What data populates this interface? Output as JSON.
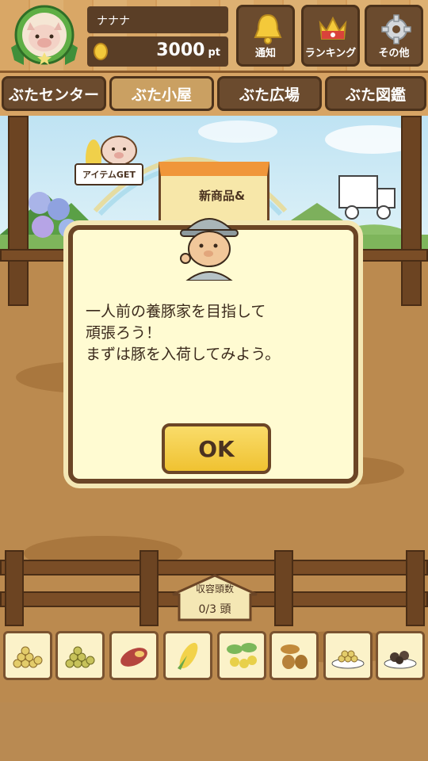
{
  "header": {
    "player_name": "ナナナ",
    "points_value": "3000",
    "points_unit": "pt",
    "buttons": [
      {
        "label": "通知",
        "icon": "bell-icon"
      },
      {
        "label": "ランキング",
        "icon": "crown-icon"
      },
      {
        "label": "その他",
        "icon": "gear-icon"
      }
    ]
  },
  "tabs": [
    {
      "label": "ぶたセンター",
      "active": false
    },
    {
      "label": "ぶた小屋",
      "active": true
    },
    {
      "label": "ぶた広場",
      "active": false
    },
    {
      "label": "ぶた図鑑",
      "active": false
    }
  ],
  "scene": {
    "item_get_label": "アイテムGET",
    "shop_sign": "新商品&"
  },
  "capacity": {
    "title": "収容頭数",
    "value": "0/3 頭"
  },
  "feeds": [
    "grain-pile-icon",
    "grain-pile-icon",
    "sweet-potato-icon",
    "corn-icon",
    "fruit-branch-icon",
    "acorn-icon",
    "grain-plate-icon",
    "rice-ball-plate-icon"
  ],
  "dialog": {
    "lines": [
      "一人前の養豚家を目指して",
      "頑張ろう！",
      "まずは豚を入荷してみよう。"
    ],
    "ok_label": "OK"
  },
  "colors": {
    "wood_dark": "#6b4526",
    "dialog_bg": "#fffbd2",
    "ok_button": "#f0c231"
  }
}
